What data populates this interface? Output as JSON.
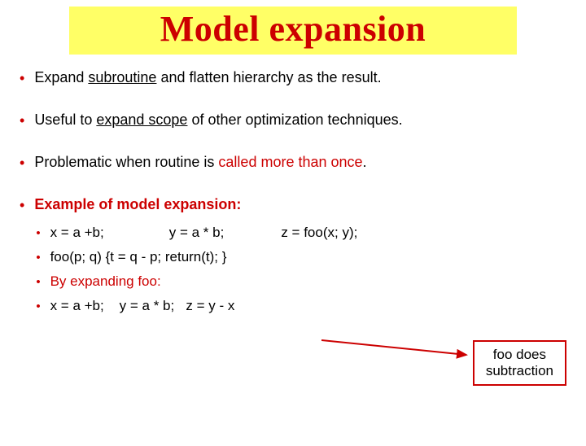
{
  "title": "Model expansion",
  "bullets": {
    "b1_pre": "Expand ",
    "b1_u": "subroutine",
    "b1_post": " and flatten hierarchy as the result.",
    "b2_pre": "Useful to ",
    "b2_u": "expand scope",
    "b2_post": " of other optimization techniques.",
    "b3_pre": "Problematic when routine is ",
    "b3_em": "called more than once",
    "b3_post": ".",
    "b4": "Example of model expansion:"
  },
  "sub": {
    "s1a": "x = a +b;",
    "s1b": "y = a * b;",
    "s1c": "z = foo(x; y);",
    "s2": "foo(p; q) {t  =  q - p; return(t); }",
    "s3": "By expanding foo:",
    "s4a": "x = a +b;",
    "s4b": "y = a * b;",
    "s4c": "z = y - x"
  },
  "callout": {
    "line1": "foo does",
    "line2": "subtraction"
  }
}
